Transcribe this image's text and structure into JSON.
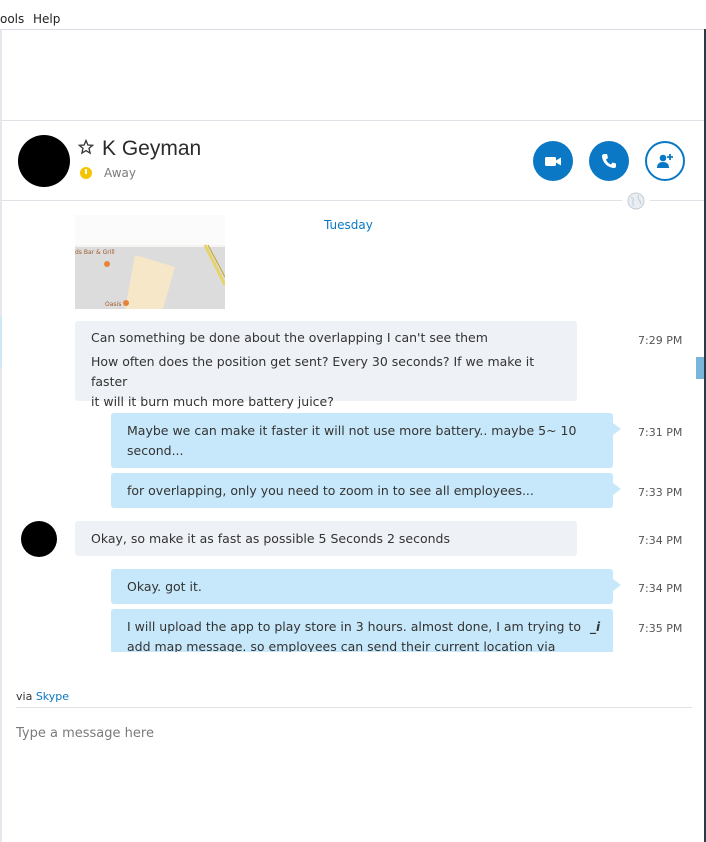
{
  "menu": {
    "tools": "ools",
    "help": "Help"
  },
  "contact": {
    "name": "K Geyman",
    "status": "Away"
  },
  "conversation": {
    "day": "Tuesday",
    "messages": [
      {
        "dir": "in",
        "lines": [
          "Can something be done about the overlapping I can't see them",
          "How often does the position get sent? Every 30 seconds? If we make it faster",
          "it will it burn much more battery juice?"
        ],
        "time": "7:29 PM"
      },
      {
        "dir": "out",
        "lines": [
          "Maybe we can make it faster it will not use more battery.. maybe 5~ 10",
          "second..."
        ],
        "time": "7:31 PM"
      },
      {
        "dir": "out",
        "lines": [
          "for overlapping, only you need to zoom in to see all employees..."
        ],
        "time": "7:33 PM"
      },
      {
        "dir": "in",
        "lines": [
          "Okay, so make it as fast as possible 5 Seconds 2 seconds"
        ],
        "time": "7:34 PM"
      },
      {
        "dir": "out",
        "lines": [
          "Okay. got it."
        ],
        "time": "7:34 PM"
      },
      {
        "dir": "out",
        "lines": [
          "I will upload the app to play store in 3 hours. almost done, I am trying to",
          "add map message. so employees can send their current location via"
        ],
        "time": "7:35 PM"
      }
    ]
  },
  "map": {
    "label1": "ds Bar & Grill",
    "label2": "Oasis"
  },
  "composer": {
    "via_prefix": "via",
    "via_link": "Skype",
    "placeholder": "Type a message here"
  },
  "icons": {
    "star": "star-outline-icon",
    "video": "video-camera-icon",
    "call": "phone-icon",
    "add": "add-person-icon",
    "globe": "globe-icon",
    "typing": "typing-indicator-icon"
  },
  "colors": {
    "accent": "#0a78c4",
    "outgoing": "#c7e8fa",
    "incoming": "#eef1f5",
    "away": "#f5c400"
  }
}
